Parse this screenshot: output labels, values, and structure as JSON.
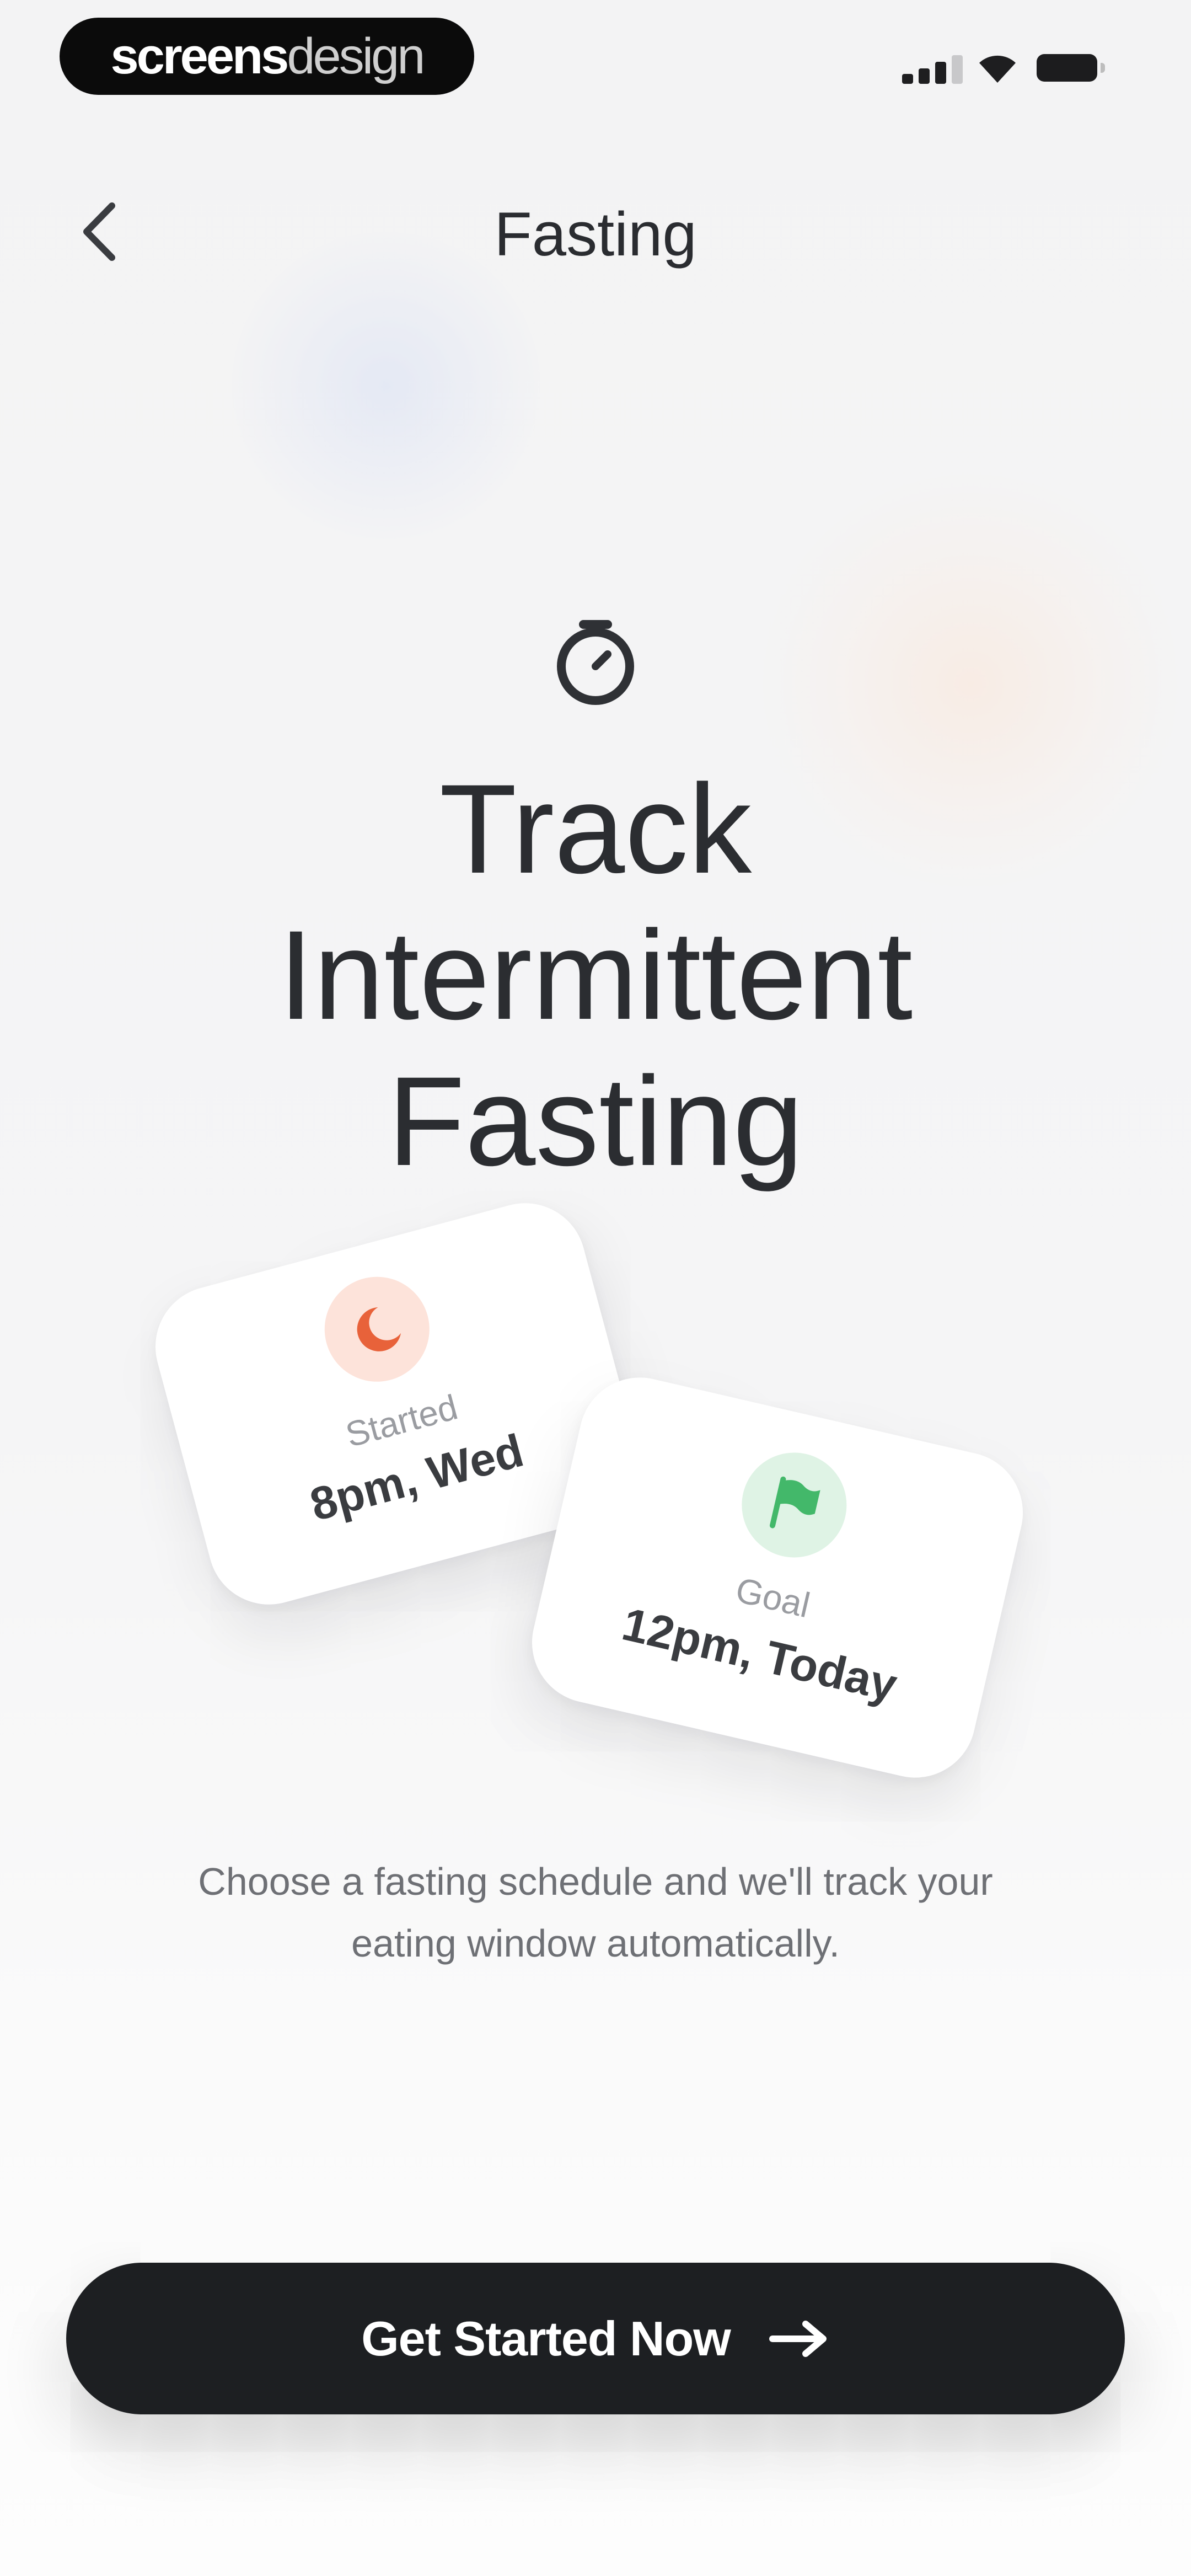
{
  "status_bar": {
    "brand_bold": "screens",
    "brand_light": "design",
    "icons": [
      "cellular-signal-icon",
      "wifi-icon",
      "battery-icon"
    ]
  },
  "nav": {
    "back_icon": "chevron-left-icon",
    "title": "Fasting"
  },
  "hero": {
    "icon": "timer-icon",
    "title_lines": [
      "Track",
      "Intermittent",
      "Fasting"
    ]
  },
  "cards": {
    "started": {
      "icon": "moon-icon",
      "label": "Started",
      "value": "8pm, Wed",
      "accent": "#e8623a"
    },
    "goal": {
      "icon": "flag-icon",
      "label": "Goal",
      "value": "12pm, Today",
      "accent": "#43b86a"
    }
  },
  "description": {
    "line1": "Choose a fasting schedule and we'll track your",
    "line2": "eating window automatically."
  },
  "cta": {
    "label": "Get Started Now",
    "icon": "arrow-right-icon",
    "background": "#1d1f22"
  }
}
